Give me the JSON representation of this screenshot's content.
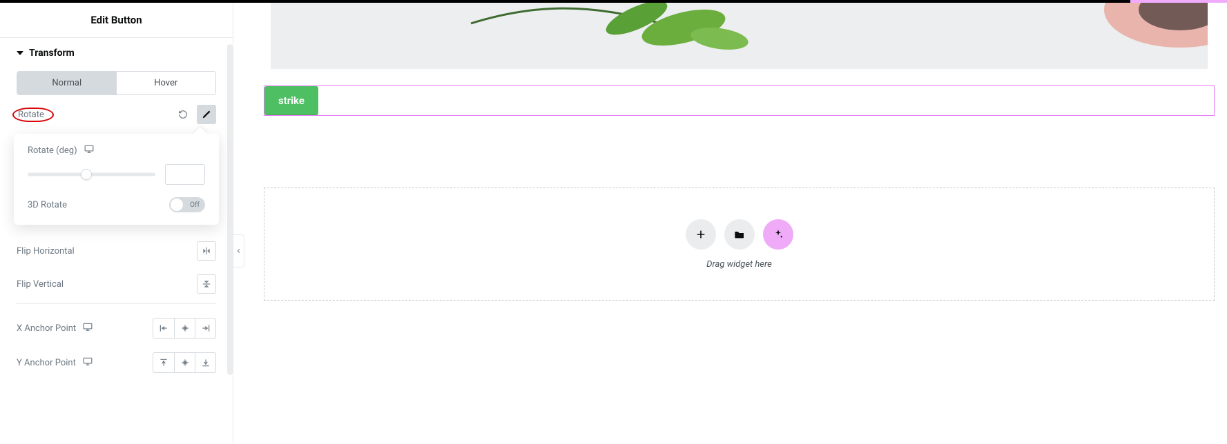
{
  "panel": {
    "title": "Edit Button",
    "section": "Transform",
    "tabs": {
      "normal": "Normal",
      "hover": "Hover"
    },
    "rotate": {
      "label": "Rotate",
      "deg_label": "Rotate (deg)",
      "value": "",
      "three_d_label": "3D Rotate",
      "three_d_state": "Off"
    },
    "flip_h": "Flip Horizontal",
    "flip_v": "Flip Vertical",
    "x_anchor": "X Anchor Point",
    "y_anchor": "Y Anchor Point"
  },
  "canvas": {
    "button_label": "strike",
    "drop_hint": "Drag widget here"
  },
  "icons": {
    "reset": "reset-icon",
    "pencil": "pencil-icon",
    "device": "desktop-icon",
    "flip_h": "flip-horizontal-icon",
    "flip_v": "flip-vertical-icon",
    "align_l": "align-left-icon",
    "align_c": "align-center-icon",
    "align_r": "align-right-icon",
    "align_t": "align-top-icon",
    "align_m": "align-middle-icon",
    "align_b": "align-bottom-icon",
    "plus": "plus-icon",
    "folder": "folder-icon",
    "sparkle": "sparkle-icon",
    "chevron_left": "chevron-left-icon"
  },
  "colors": {
    "accent_pink": "#e879f9",
    "button_green": "#4fbf63"
  }
}
